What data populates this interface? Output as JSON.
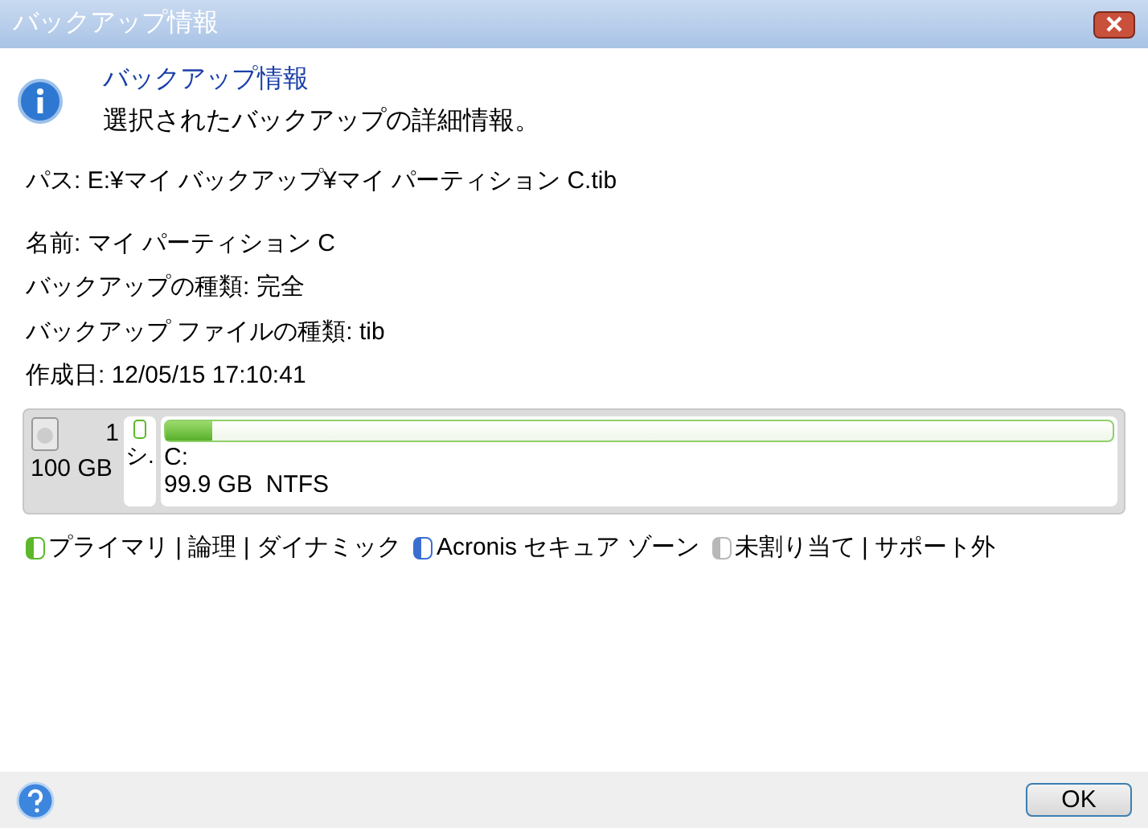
{
  "window": {
    "title": "バックアップ情報"
  },
  "header": {
    "title": "バックアップ情報",
    "subtitle": "選択されたバックアップの詳細情報。"
  },
  "path": "パス: E:¥マイ バックアップ¥マイ パーティション C.tib",
  "details": [
    "名前: マイ パーティション C",
    "バックアップの種類: 完全",
    "バックアップ ファイルの種類: tib",
    "作成日: 12/05/15 17:10:41"
  ],
  "disk": {
    "number": "1",
    "size": "100 GB",
    "slot_label": "シ.",
    "partition": {
      "name": "C:",
      "info": "99.9 GB  NTFS",
      "level": 0.05
    }
  },
  "legend": [
    {
      "label": "プライマリ | 論理 | ダイナミック",
      "color": "#5cb82a"
    },
    {
      "label": "Acronis セキュア ゾーン",
      "color": "#3a6fd0"
    },
    {
      "label": "未割り当て | サポート外",
      "color": "#b8b8b8"
    }
  ],
  "buttons": {
    "ok": "OK"
  }
}
